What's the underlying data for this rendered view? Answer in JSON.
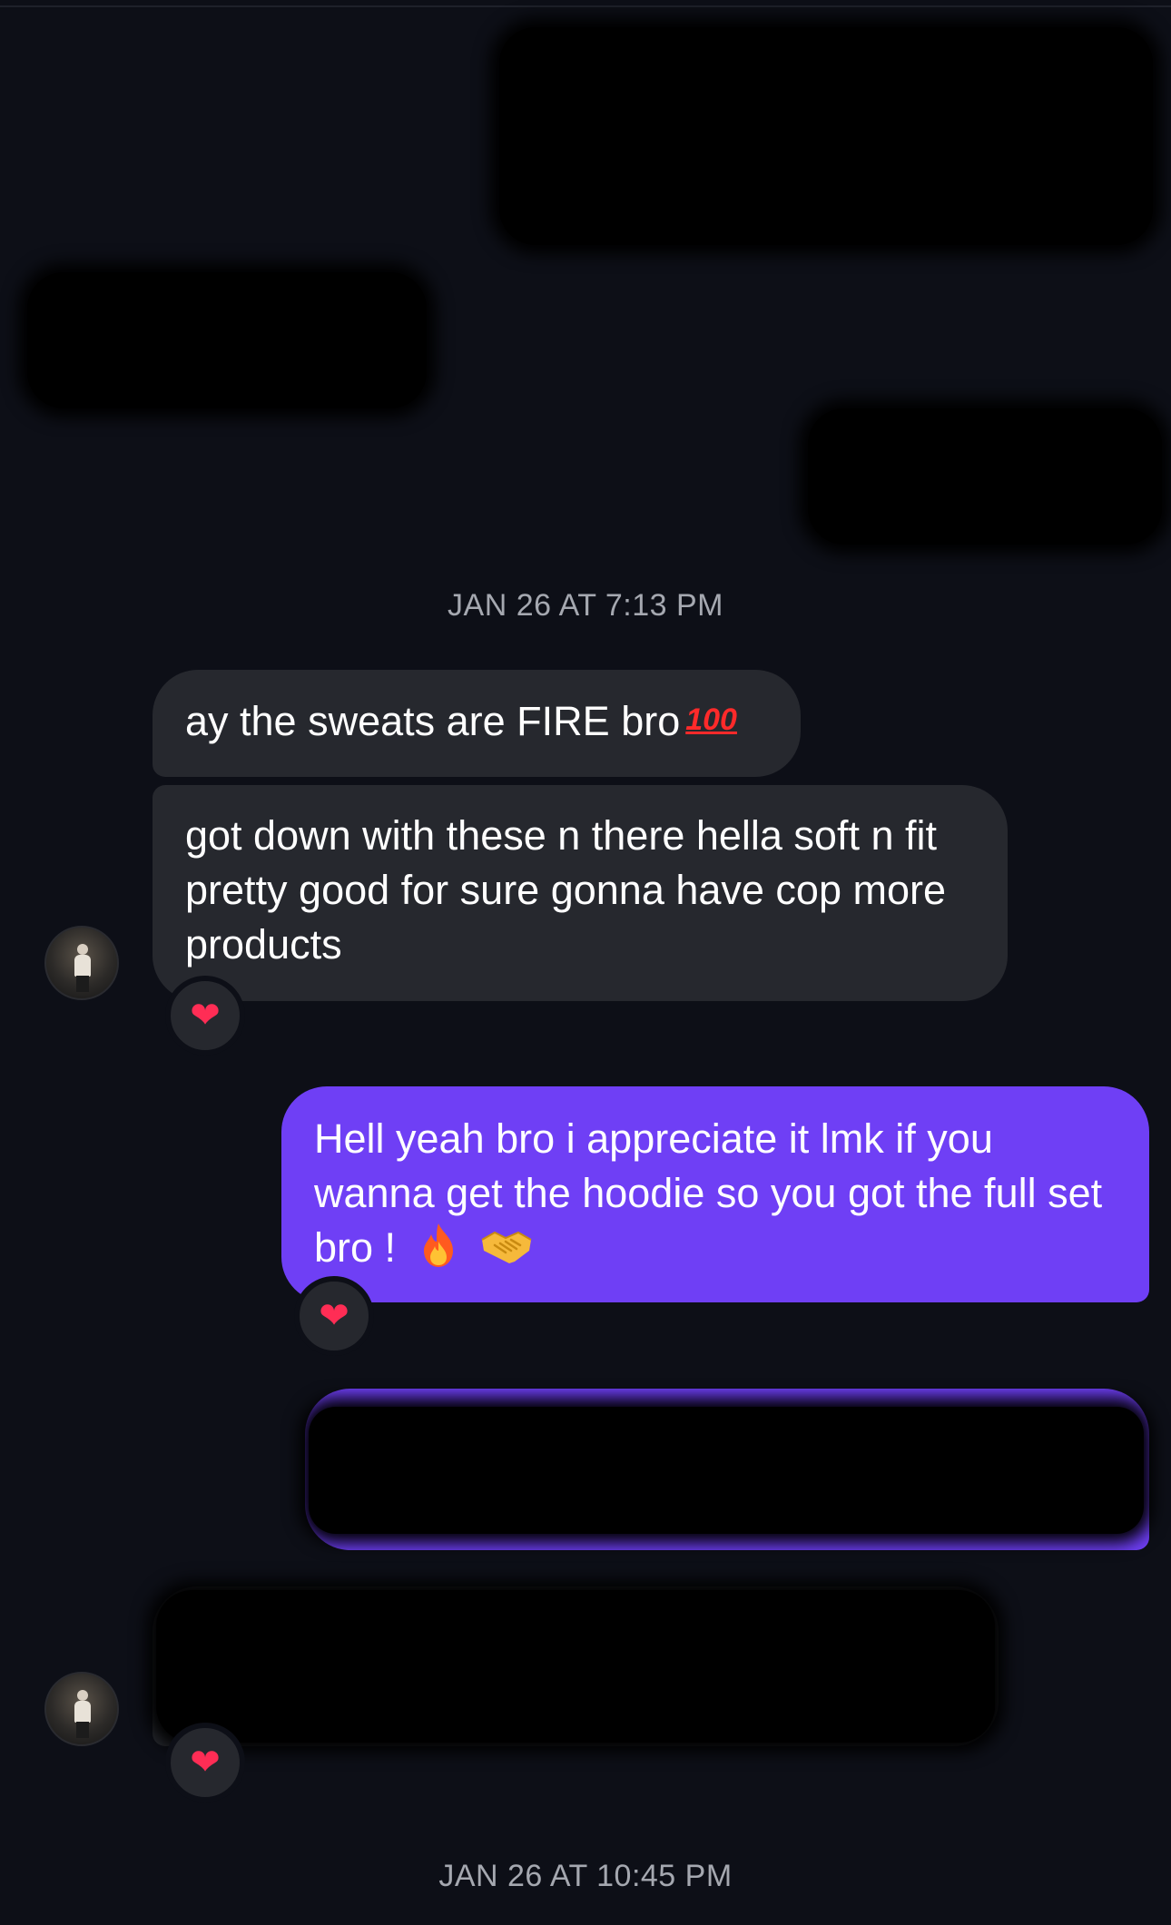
{
  "timestamps": {
    "first": "JAN 26 AT 7:13 PM",
    "second": "JAN 26 AT 10:45 PM"
  },
  "messages": [
    {
      "direction": "incoming",
      "text": "ay the sweats are FIRE bro",
      "emoji": "100"
    },
    {
      "direction": "incoming",
      "text": "got down with these n there hella soft n fit pretty good for sure gonna have cop more products",
      "reaction": "❤"
    },
    {
      "direction": "outgoing",
      "text": "Hell yeah bro i appreciate it lmk if you wanna get the hoodie so you got the full set bro !",
      "emojis": [
        "fire-icon",
        "handshake-icon"
      ],
      "reaction": "❤"
    },
    {
      "direction": "outgoing",
      "text": "",
      "redacted": true
    },
    {
      "direction": "incoming",
      "text": "",
      "redacted": true,
      "reaction": "❤"
    }
  ],
  "colors": {
    "background": "#0d0f17",
    "incoming_bubble": "#26282e",
    "outgoing_bubble": "#6f3ff5",
    "timestamp_text": "#a5a8b0",
    "heart": "#ff2d55"
  }
}
